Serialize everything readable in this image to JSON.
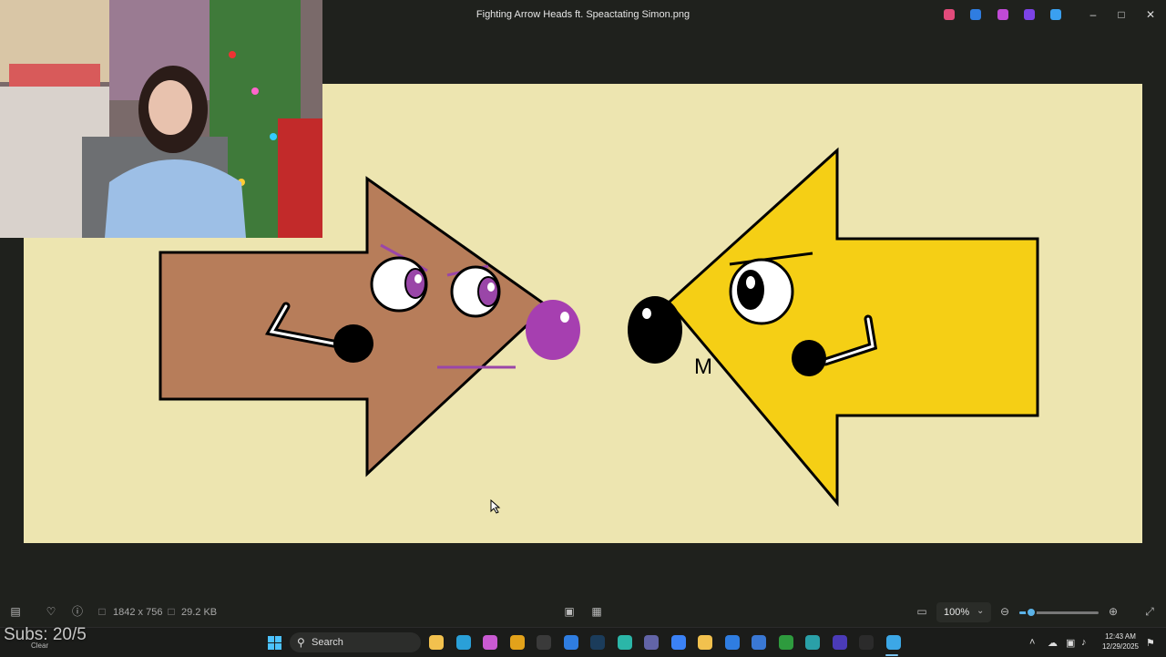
{
  "window": {
    "title": "Fighting Arrow Heads ft. Speactating Simon.png",
    "minimize_icon": "minimize-icon",
    "maximize_icon": "maximize-icon",
    "close_icon": "close-icon"
  },
  "title_apps": [
    {
      "name": "copilot-icon",
      "color": "#e14b7b"
    },
    {
      "name": "designer-icon",
      "color": "#2f7de1"
    },
    {
      "name": "clipchamp-icon",
      "color": "#c04ad6"
    },
    {
      "name": "purple-app-icon",
      "color": "#7c43e6"
    },
    {
      "name": "onedrive-icon",
      "color": "#3aa0f0"
    }
  ],
  "image": {
    "background_color": "#ede5b0",
    "brown_arrow_color": "#b77d5a",
    "yellow_arrow_color": "#f5cf15",
    "nose_color": "#a63fb0",
    "brow_color": "#9a46a8",
    "letter_mark": "M"
  },
  "statusbar": {
    "dimensions": "1842 x 756",
    "file_size": "29.2 KB",
    "zoom": "100%",
    "zoom_level_fraction": 0.15
  },
  "taskbar": {
    "search_placeholder": "Search",
    "apps": [
      {
        "name": "file-explorer-app-icon",
        "color": "#f2c14e"
      },
      {
        "name": "edge-icon",
        "color": "#2aa0d8"
      },
      {
        "name": "copilot-app-icon",
        "color": "#c95ad2"
      },
      {
        "name": "chrome-icon",
        "color": "#e3a21a"
      },
      {
        "name": "epic-games-icon",
        "color": "#3a3a3a"
      },
      {
        "name": "azure-app-icon",
        "color": "#2f7de1"
      },
      {
        "name": "steam-icon",
        "color": "#1b3c5b"
      },
      {
        "name": "app-teal-icon",
        "color": "#2bb6a8"
      },
      {
        "name": "teams-icon",
        "color": "#6264a7"
      },
      {
        "name": "health-icon",
        "color": "#3b82f6"
      },
      {
        "name": "folder-icon",
        "color": "#f2c14e"
      },
      {
        "name": "mail-icon",
        "color": "#2f7de1"
      },
      {
        "name": "store-icon",
        "color": "#3a78d4"
      },
      {
        "name": "xbox-icon",
        "color": "#2e9b3e"
      },
      {
        "name": "globe-app-icon",
        "color": "#2aa0a8"
      },
      {
        "name": "notes-app-icon",
        "color": "#4b3bb8"
      },
      {
        "name": "obs-icon",
        "color": "#2b2b2b"
      },
      {
        "name": "photos-icon",
        "color": "#3ca7e6"
      }
    ],
    "clock_time": "12:43 AM",
    "clock_date": "12/29/2025"
  },
  "overlay": {
    "subs_text": "Subs: 20/5",
    "weather_text": "Clear"
  }
}
